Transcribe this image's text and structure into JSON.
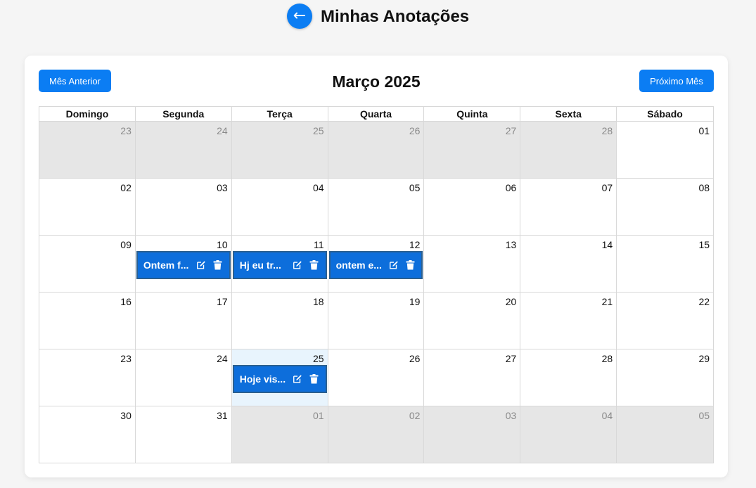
{
  "header": {
    "back_icon": "←",
    "title": "Minhas Anotações"
  },
  "calendar": {
    "prev_label": "Mês Anterior",
    "next_label": "Próximo Mês",
    "month_title": "Março 2025",
    "weekdays": [
      "Domingo",
      "Segunda",
      "Terça",
      "Quarta",
      "Quinta",
      "Sexta",
      "Sábado"
    ],
    "weeks": [
      [
        {
          "day": "23",
          "other": true
        },
        {
          "day": "24",
          "other": true
        },
        {
          "day": "25",
          "other": true
        },
        {
          "day": "26",
          "other": true
        },
        {
          "day": "27",
          "other": true
        },
        {
          "day": "28",
          "other": true
        },
        {
          "day": "01"
        }
      ],
      [
        {
          "day": "02"
        },
        {
          "day": "03"
        },
        {
          "day": "04"
        },
        {
          "day": "05"
        },
        {
          "day": "06"
        },
        {
          "day": "07"
        },
        {
          "day": "08"
        }
      ],
      [
        {
          "day": "09"
        },
        {
          "day": "10",
          "note": "Ontem f..."
        },
        {
          "day": "11",
          "note": "Hj eu tr..."
        },
        {
          "day": "12",
          "note": "ontem e..."
        },
        {
          "day": "13"
        },
        {
          "day": "14"
        },
        {
          "day": "15"
        }
      ],
      [
        {
          "day": "16"
        },
        {
          "day": "17"
        },
        {
          "day": "18"
        },
        {
          "day": "19"
        },
        {
          "day": "20"
        },
        {
          "day": "21"
        },
        {
          "day": "22"
        }
      ],
      [
        {
          "day": "23"
        },
        {
          "day": "24"
        },
        {
          "day": "25",
          "today": true,
          "note": "Hoje vis..."
        },
        {
          "day": "26"
        },
        {
          "day": "27"
        },
        {
          "day": "28"
        },
        {
          "day": "29"
        }
      ],
      [
        {
          "day": "30"
        },
        {
          "day": "31"
        },
        {
          "day": "01",
          "other": true
        },
        {
          "day": "02",
          "other": true
        },
        {
          "day": "03",
          "other": true
        },
        {
          "day": "04",
          "other": true
        },
        {
          "day": "05",
          "other": true
        }
      ]
    ]
  },
  "colors": {
    "accent": "#0b7df3",
    "note_bg": "#0d6edb",
    "note_border": "#2b5f8f",
    "other_month_bg": "#e6e6e6",
    "today_bg": "#e8f4fd"
  },
  "icons": {
    "edit": "edit-icon",
    "delete": "trash-icon"
  }
}
